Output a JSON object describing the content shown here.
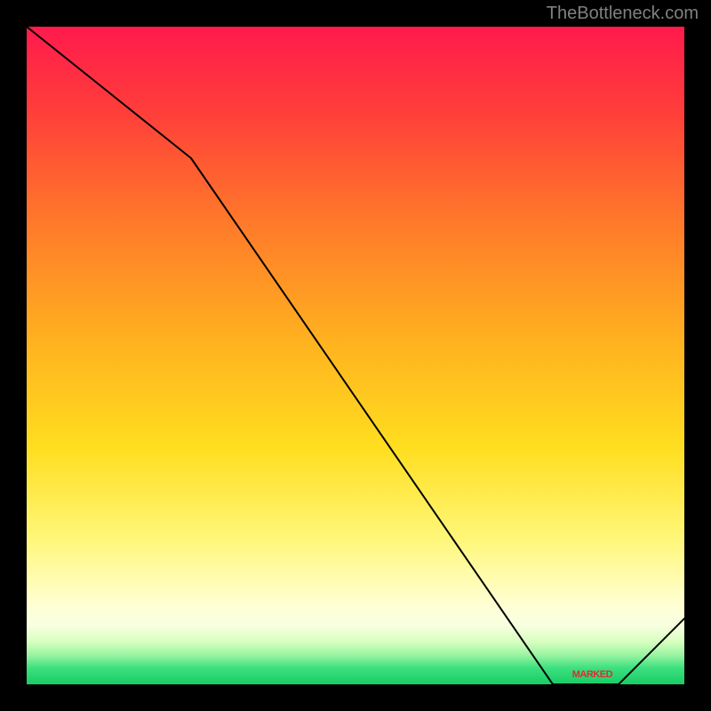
{
  "attribution": "TheBottleneck.com",
  "marker_label": "MARKED",
  "chart_data": {
    "type": "line",
    "title": "",
    "xlabel": "",
    "ylabel": "",
    "xlim": [
      0,
      100
    ],
    "ylim": [
      0,
      100
    ],
    "x": [
      0,
      25,
      80,
      90,
      100
    ],
    "values": [
      100,
      80,
      0,
      0,
      10
    ],
    "notes": "Vertical background gradient from red (top) through orange/yellow to pale yellow, with a thin green band near the bottom. Black curve descends from top-left, slope steepens after x≈25, reaches bottom around x≈80, stays flat to x≈90 (marked region), then rises toward bottom-right corner.",
    "annotations": [
      {
        "x": 86,
        "y": 1.5,
        "text": "MARKED"
      }
    ],
    "gradient_stops": [
      {
        "pos": 0.0,
        "color": "#ff1a4d"
      },
      {
        "pos": 0.12,
        "color": "#ff3b3b"
      },
      {
        "pos": 0.3,
        "color": "#ff7a2a"
      },
      {
        "pos": 0.48,
        "color": "#ffb21f"
      },
      {
        "pos": 0.64,
        "color": "#ffde1f"
      },
      {
        "pos": 0.78,
        "color": "#fff77a"
      },
      {
        "pos": 0.88,
        "color": "#ffffd4"
      },
      {
        "pos": 0.91,
        "color": "#f8ffe0"
      },
      {
        "pos": 0.935,
        "color": "#d8ffc0"
      },
      {
        "pos": 0.955,
        "color": "#9cf4a3"
      },
      {
        "pos": 0.975,
        "color": "#3de07e"
      },
      {
        "pos": 1.0,
        "color": "#18cc66"
      }
    ]
  }
}
